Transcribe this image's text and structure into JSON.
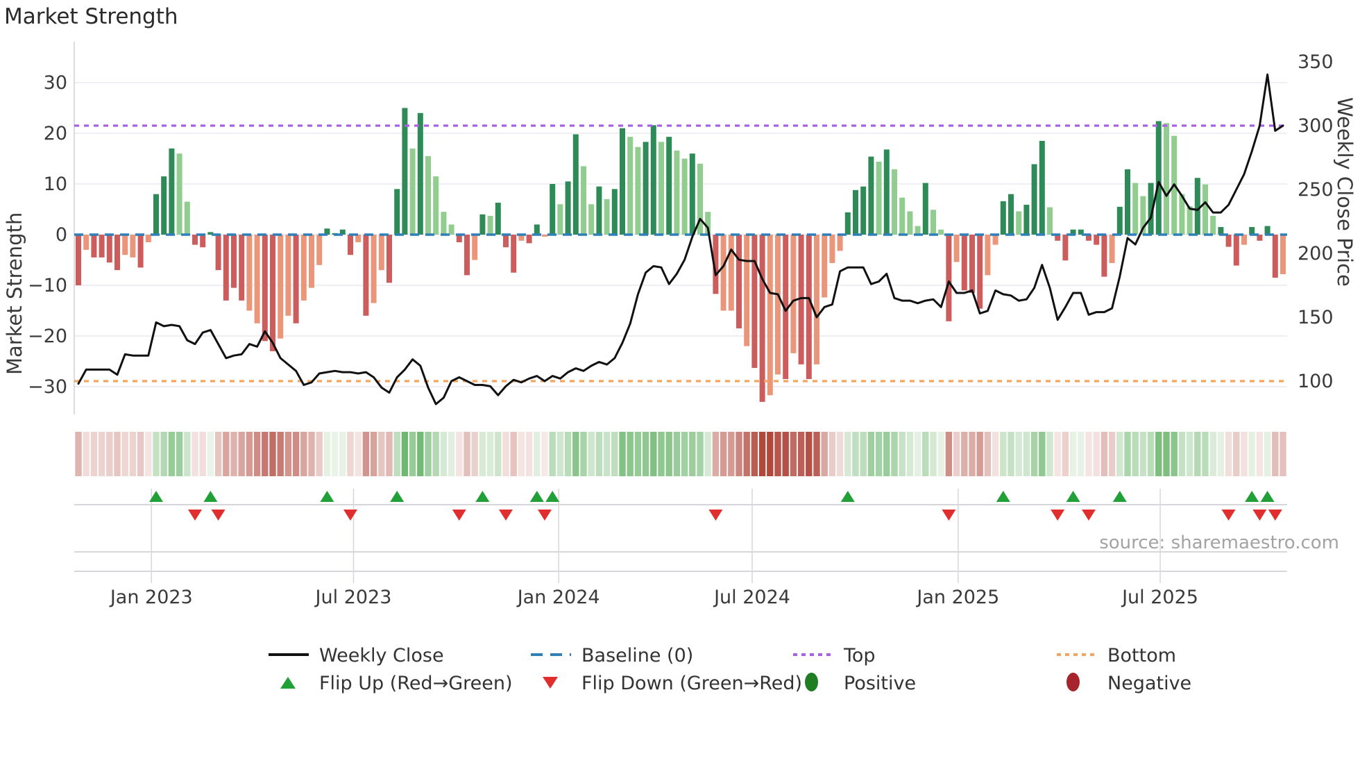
{
  "title": "Market Strength",
  "left_axis_title": "Market Strength",
  "right_axis_title": "Weekly Close Price",
  "source": "source: sharemaestro.com",
  "legend": {
    "weekly_close": "Weekly Close",
    "baseline": "Baseline (0)",
    "top": "Top",
    "bottom": "Bottom",
    "flip_up": "Flip Up (Red→Green)",
    "flip_down": "Flip Down (Green→Red)",
    "positive": "Positive",
    "negative": "Negative"
  },
  "colors": {
    "bar_positive_dark": "#2e8b57",
    "bar_positive_light": "#90cd8e",
    "bar_negative_dark": "#cd5c5c",
    "bar_negative_light": "#e9967a",
    "baseline_blue": "#2f7fb8",
    "top_purple": "#a95fe6",
    "bottom_orange": "#f3a55f",
    "price_line": "#111111",
    "flip_up_green": "#21a038",
    "flip_down_red": "#e02d2d",
    "grid": "#e8e8f0",
    "tick_text": "#3a3a3a"
  },
  "chart_data": {
    "type": "bar",
    "title": "Market Strength",
    "xlabel": "",
    "ylabel_left": "Market Strength",
    "ylabel_right": "Weekly Close Price",
    "left_ticks": [
      "30",
      "20",
      "10",
      "0",
      "−10",
      "−20",
      "−30"
    ],
    "left_tick_values": [
      30,
      20,
      10,
      0,
      -10,
      -20,
      -30
    ],
    "left_range": [
      -35,
      38
    ],
    "right_ticks": [
      "350",
      "300",
      "250",
      "200",
      "150",
      "100"
    ],
    "right_tick_values": [
      350,
      300,
      250,
      200,
      150,
      100
    ],
    "right_range": [
      75,
      355
    ],
    "x_ticks": [
      {
        "label": "Jan 2023",
        "week": 9.4
      },
      {
        "label": "Jul 2023",
        "week": 35.4
      },
      {
        "label": "Jan 2024",
        "week": 61.8
      },
      {
        "label": "Jul 2024",
        "week": 86.7
      },
      {
        "label": "Jan 2025",
        "week": 113.2
      },
      {
        "label": "Jul 2025",
        "week": 139.2
      }
    ],
    "baseline_value": 0,
    "top_line_price": 300,
    "bottom_line_price": 100,
    "series": [
      {
        "name": "Market Strength",
        "type": "bar",
        "values": [
          -10,
          -3,
          -4.5,
          -4.5,
          -5.5,
          -7,
          -4,
          -4.5,
          -6.5,
          -1.5,
          8,
          11.5,
          17,
          16,
          6.5,
          -2,
          -2.5,
          0.5,
          -7,
          -13,
          -10.5,
          -13,
          -15,
          -17.5,
          -21,
          -23,
          -20.5,
          -16,
          -17.5,
          -13,
          -10.5,
          -6,
          1.2,
          0.3,
          1,
          -4,
          -1.5,
          -16,
          -13.5,
          -7,
          -9.5,
          9,
          25,
          17,
          24,
          15.5,
          11.5,
          4.5,
          2,
          -1.5,
          -8,
          -5,
          4,
          3.7,
          6.3,
          -2.5,
          -7.5,
          -1.2,
          -1.7,
          2,
          -0.4,
          10,
          6,
          10.5,
          19.8,
          13.5,
          6,
          9.5,
          7,
          9,
          21,
          19.3,
          17.3,
          18.3,
          21.6,
          18.3,
          19.3,
          16.6,
          15,
          16,
          14,
          4.5,
          -11.7,
          -15,
          -15,
          -18.5,
          -22,
          -26.3,
          -33,
          -31.7,
          -27.6,
          -28.5,
          -23.4,
          -25.6,
          -28.5,
          -25.6,
          -12.4,
          -5.6,
          -3.2,
          4.4,
          8.8,
          9.5,
          15.4,
          14.4,
          16.8,
          12.9,
          7.3,
          4.6,
          1.7,
          10.2,
          4.9,
          1,
          -17.1,
          -5.4,
          -11,
          -11.5,
          -14.6,
          -8,
          -2,
          6.6,
          8,
          4.6,
          5.9,
          13.9,
          18.5,
          5.4,
          -1.2,
          -5.1,
          1,
          1,
          -1.2,
          -2,
          -8.3,
          -5.6,
          5.5,
          12.9,
          10.2,
          7.6,
          10.2,
          22.4,
          22,
          19.5,
          8,
          5.6,
          11.2,
          9.9,
          3.7,
          1.5,
          -2.4,
          -6.1,
          -2,
          1.5,
          -1.2,
          1.7,
          -8.5,
          -7.8
        ]
      },
      {
        "name": "Shade (1=dark,0=light)",
        "type": "meta",
        "values": [
          1,
          0,
          1,
          1,
          1,
          1,
          0,
          0,
          1,
          0,
          1,
          1,
          1,
          0,
          0,
          1,
          1,
          1,
          1,
          1,
          1,
          1,
          0,
          0,
          1,
          1,
          0,
          0,
          1,
          0,
          0,
          0,
          1,
          1,
          1,
          1,
          0,
          1,
          0,
          0,
          1,
          1,
          1,
          0,
          1,
          0,
          0,
          0,
          0,
          1,
          1,
          0,
          1,
          0,
          1,
          1,
          1,
          0,
          1,
          1,
          0,
          1,
          0,
          1,
          1,
          0,
          0,
          1,
          0,
          1,
          1,
          0,
          0,
          1,
          1,
          0,
          1,
          0,
          0,
          1,
          0,
          0,
          1,
          0,
          0,
          1,
          0,
          1,
          1,
          0,
          0,
          1,
          0,
          1,
          1,
          0,
          0,
          0,
          0,
          1,
          1,
          1,
          1,
          0,
          1,
          0,
          0,
          0,
          0,
          1,
          0,
          0,
          1,
          0,
          1,
          1,
          1,
          0,
          0,
          1,
          1,
          0,
          1,
          1,
          1,
          0,
          1,
          1,
          1,
          1,
          1,
          1,
          1,
          0,
          1,
          1,
          0,
          0,
          1,
          1,
          0,
          0,
          0,
          0,
          1,
          0,
          0,
          1,
          1,
          1,
          0,
          1,
          1,
          1,
          1,
          0
        ]
      },
      {
        "name": "Weekly Close",
        "type": "line",
        "values": [
          98,
          109,
          109,
          109,
          109,
          105,
          121,
          120,
          120,
          120,
          146,
          143,
          144,
          143,
          132,
          129,
          138,
          140,
          129,
          118,
          120,
          121,
          129,
          127,
          139,
          130,
          118,
          113,
          108,
          97,
          99,
          106,
          107,
          108,
          107,
          107,
          106,
          107,
          103,
          95,
          91,
          103,
          109,
          117,
          112,
          95,
          82,
          87,
          100,
          103,
          100,
          97,
          97,
          96,
          89,
          96,
          101,
          99,
          102,
          104,
          100,
          104,
          102,
          107,
          110,
          108,
          112,
          115,
          113,
          118,
          130,
          145,
          168,
          185,
          190,
          189,
          176,
          184,
          195,
          213,
          227,
          220,
          183,
          190,
          203,
          195,
          194,
          194,
          180,
          169,
          168,
          155,
          163,
          165,
          165,
          150,
          158,
          160,
          186,
          189,
          189,
          189,
          176,
          178,
          184,
          165,
          163,
          163,
          161,
          163,
          164,
          158,
          178,
          169,
          169,
          171,
          153,
          155,
          171,
          168,
          167,
          163,
          164,
          173,
          191,
          173,
          148,
          158,
          169,
          169,
          152,
          154,
          154,
          157,
          182,
          212,
          207,
          220,
          228,
          256,
          245,
          254,
          245,
          235,
          234,
          240,
          232,
          232,
          238,
          250,
          262,
          280,
          300,
          340,
          296,
          300
        ]
      }
    ],
    "flip_up_weeks": [
      10,
      17,
      32,
      41,
      52,
      59,
      61,
      99,
      119,
      128,
      134,
      151,
      153
    ],
    "flip_down_weeks": [
      15,
      18,
      35,
      49,
      55,
      60,
      82,
      112,
      126,
      130,
      148,
      152,
      154
    ],
    "heatmap": "strip below chart uses same weekly strength values on red-green diverging scale",
    "legend_position": "bottom-center",
    "grid": true
  }
}
